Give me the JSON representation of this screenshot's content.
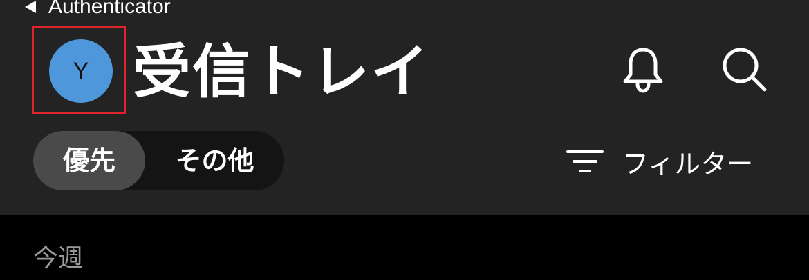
{
  "nav": {
    "back_label": "Authenticator"
  },
  "header": {
    "avatar_initial": "Y",
    "title": "受信トレイ",
    "icons": [
      "bell-icon",
      "search-icon"
    ],
    "colors": {
      "background": "#232323",
      "avatar": "#4e97db",
      "highlight_border": "#e0232b"
    }
  },
  "tabs": [
    {
      "label": "優先",
      "selected": true
    },
    {
      "label": "その他",
      "selected": false
    }
  ],
  "filter": {
    "label": "フィルター",
    "icon": "filter-icon"
  },
  "list": {
    "section_label": "今週"
  }
}
